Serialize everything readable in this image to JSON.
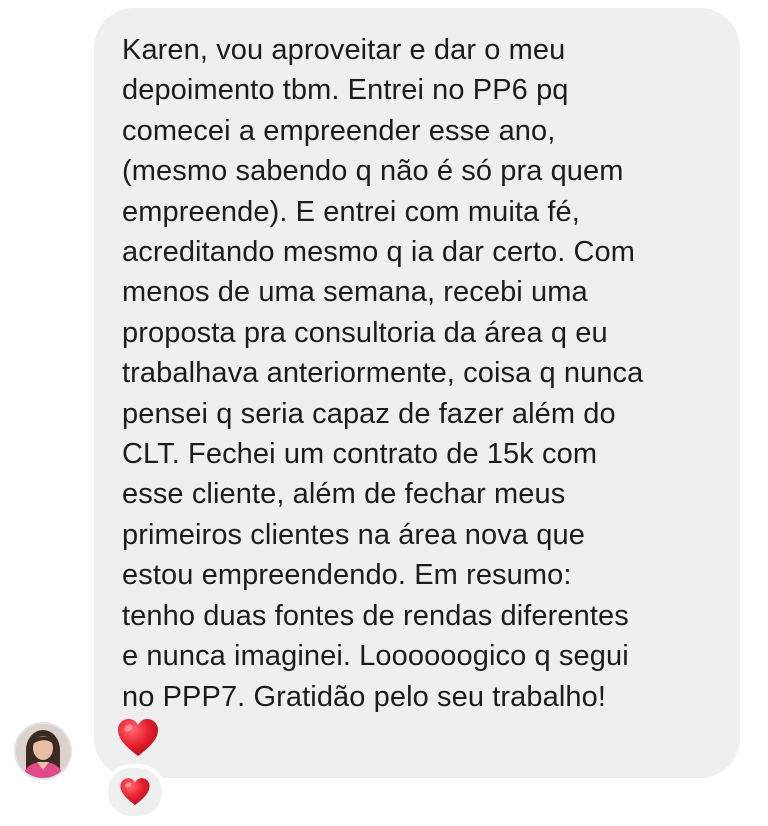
{
  "message": {
    "lines": [
      "Karen, vou aproveitar e dar o meu",
      "depoimento tbm. Entrei no PP6 pq",
      "comecei a empreender esse ano,",
      "(mesmo sabendo q não é só pra quem",
      "empreende). E entrei com muita fé,",
      "acreditando mesmo q ia dar certo. Com",
      "menos de uma semana, recebi uma",
      "proposta pra consultoria da área q eu",
      "trabalhava anteriormente, coisa q nunca",
      "pensei q seria capaz de fazer além do",
      "CLT. Fechei um contrato de 15k com",
      "esse cliente, além de fechar meus",
      "primeiros clientes na área nova que",
      "estou empreendendo. Em resumo:",
      "tenho duas fontes de rendas diferentes",
      "e nunca imaginei. Loooooogico q segui",
      "no PPP7. Gratidão pelo seu trabalho!"
    ],
    "inline_emoji": "heart-icon",
    "reaction": "heart-icon"
  },
  "colors": {
    "bubble_bg": "#efefef",
    "text": "#1c1c1e",
    "heart": "#e8202f"
  },
  "sender": {
    "avatar": "avatar"
  }
}
